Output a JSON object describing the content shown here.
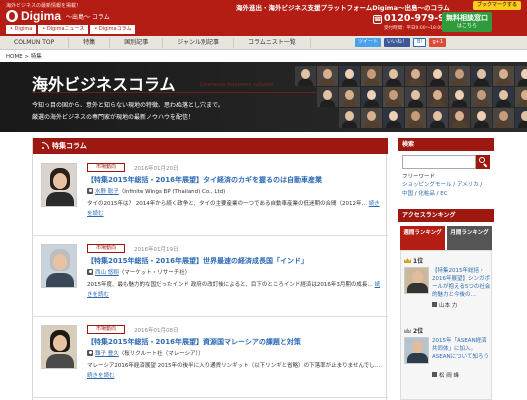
{
  "header": {
    "tagline": "海外ビジネスの最新情報を掲載！",
    "logo_text": "Digima",
    "logo_sub": "〜出島〜 コラム",
    "top_tabs": [
      "• Digima",
      "• Digimaニュース",
      "• Digimaコラム"
    ],
    "headline": "海外進出・海外ビジネス支援プラットフォームDigima〜出島〜のコラム",
    "bookmark_label": "ブックマークする",
    "phone_number": "0120-979-938",
    "phone_hours": "受付時間：平日9:00〜18:00",
    "consult_label": "無料相談窓口",
    "consult_sub": "はこちら"
  },
  "nav": {
    "items": [
      "COLMUN TOP",
      "特集",
      "国別記事",
      "ジャンル別記事",
      "コラムニスト一覧"
    ],
    "share_twitter": "ツイート",
    "share_facebook": "いいね！",
    "share_hatena": "B!",
    "share_gplus": "g+1"
  },
  "breadcrumb": "HOME > 特集",
  "hero": {
    "title": "海外ビジネスコラム",
    "script": "Overseas business column",
    "desc1": "今知っ目の国から、意外と知らない現地の特徴、思わぬ落とし穴まで。",
    "desc2": "厳選の海外ビジネスの専門家が現地の最新ノウハウを配信！"
  },
  "section": {
    "title": "特集コラム"
  },
  "articles": [
    {
      "category": "市場動向",
      "date": "2016年01月20日",
      "title": "【特集2015年総括・2016年展望】タイ経済のカギを握るのは自動車産業",
      "author_name": "水野 聡子",
      "author_org": "（Infinite Wings BP (Thailand) Co., Ltd)",
      "excerpt": "タイの2015年は？ 2014年から続く政争と、タイの主要産業の一つである自動車産業の低迷期の合間（2012年…",
      "read_more": "続きを読む"
    },
    {
      "category": "市場動向",
      "date": "2016年01月19日",
      "title": "【特集2015年総括・2016年展望】世界最速の経済成長国「インド」",
      "author_name": "西山 悠翔",
      "author_org": "（マーケット・リサーチ社）",
      "excerpt": "2015年度、最も魅力的な国だったインド 政府の改訂後によると、目下のところインド経済は2016年3月期の成長…",
      "read_more": "続きを読む"
    },
    {
      "category": "市場動向",
      "date": "2016年01月08日",
      "title": "【特集2015年総括・2016年展望】資源国マレーシアの課題と対策",
      "author_name": "難子 豊久",
      "author_org": "（桜リクルート社（マレーシア））",
      "excerpt": "マレーシア2016年経済展望 2015年の後半に入り通貨リンギット（以下リンギと省略）の下落率が止まりませんでし…",
      "read_more": "続きを読む"
    }
  ],
  "sidebar": {
    "search_title": "検索",
    "freeword_label": "フリーワード",
    "keywords": [
      "ショッピングモール",
      "アメリカ",
      "中国",
      "化粧品",
      "EC"
    ],
    "ranking_title": "アクセスランキング",
    "tab_weekly": "週間ランキング",
    "tab_monthly": "月間ランキング",
    "ranks": [
      {
        "label": "1位",
        "text": "【特集2015年総括・2016年展望】シンガポールが抱える5つの社会的魅力と今後の…",
        "author": "山本 力"
      },
      {
        "label": "2位",
        "text": "2015年「ASEAN経済共同体」に加入。ASEANについて知ろう",
        "author": "松 岡 峰"
      }
    ]
  },
  "colors": {
    "brand_red": "#b31d13",
    "section_red": "#9e1812",
    "link_blue": "#2d6ab4",
    "consult_green": "#2f9b3c"
  }
}
